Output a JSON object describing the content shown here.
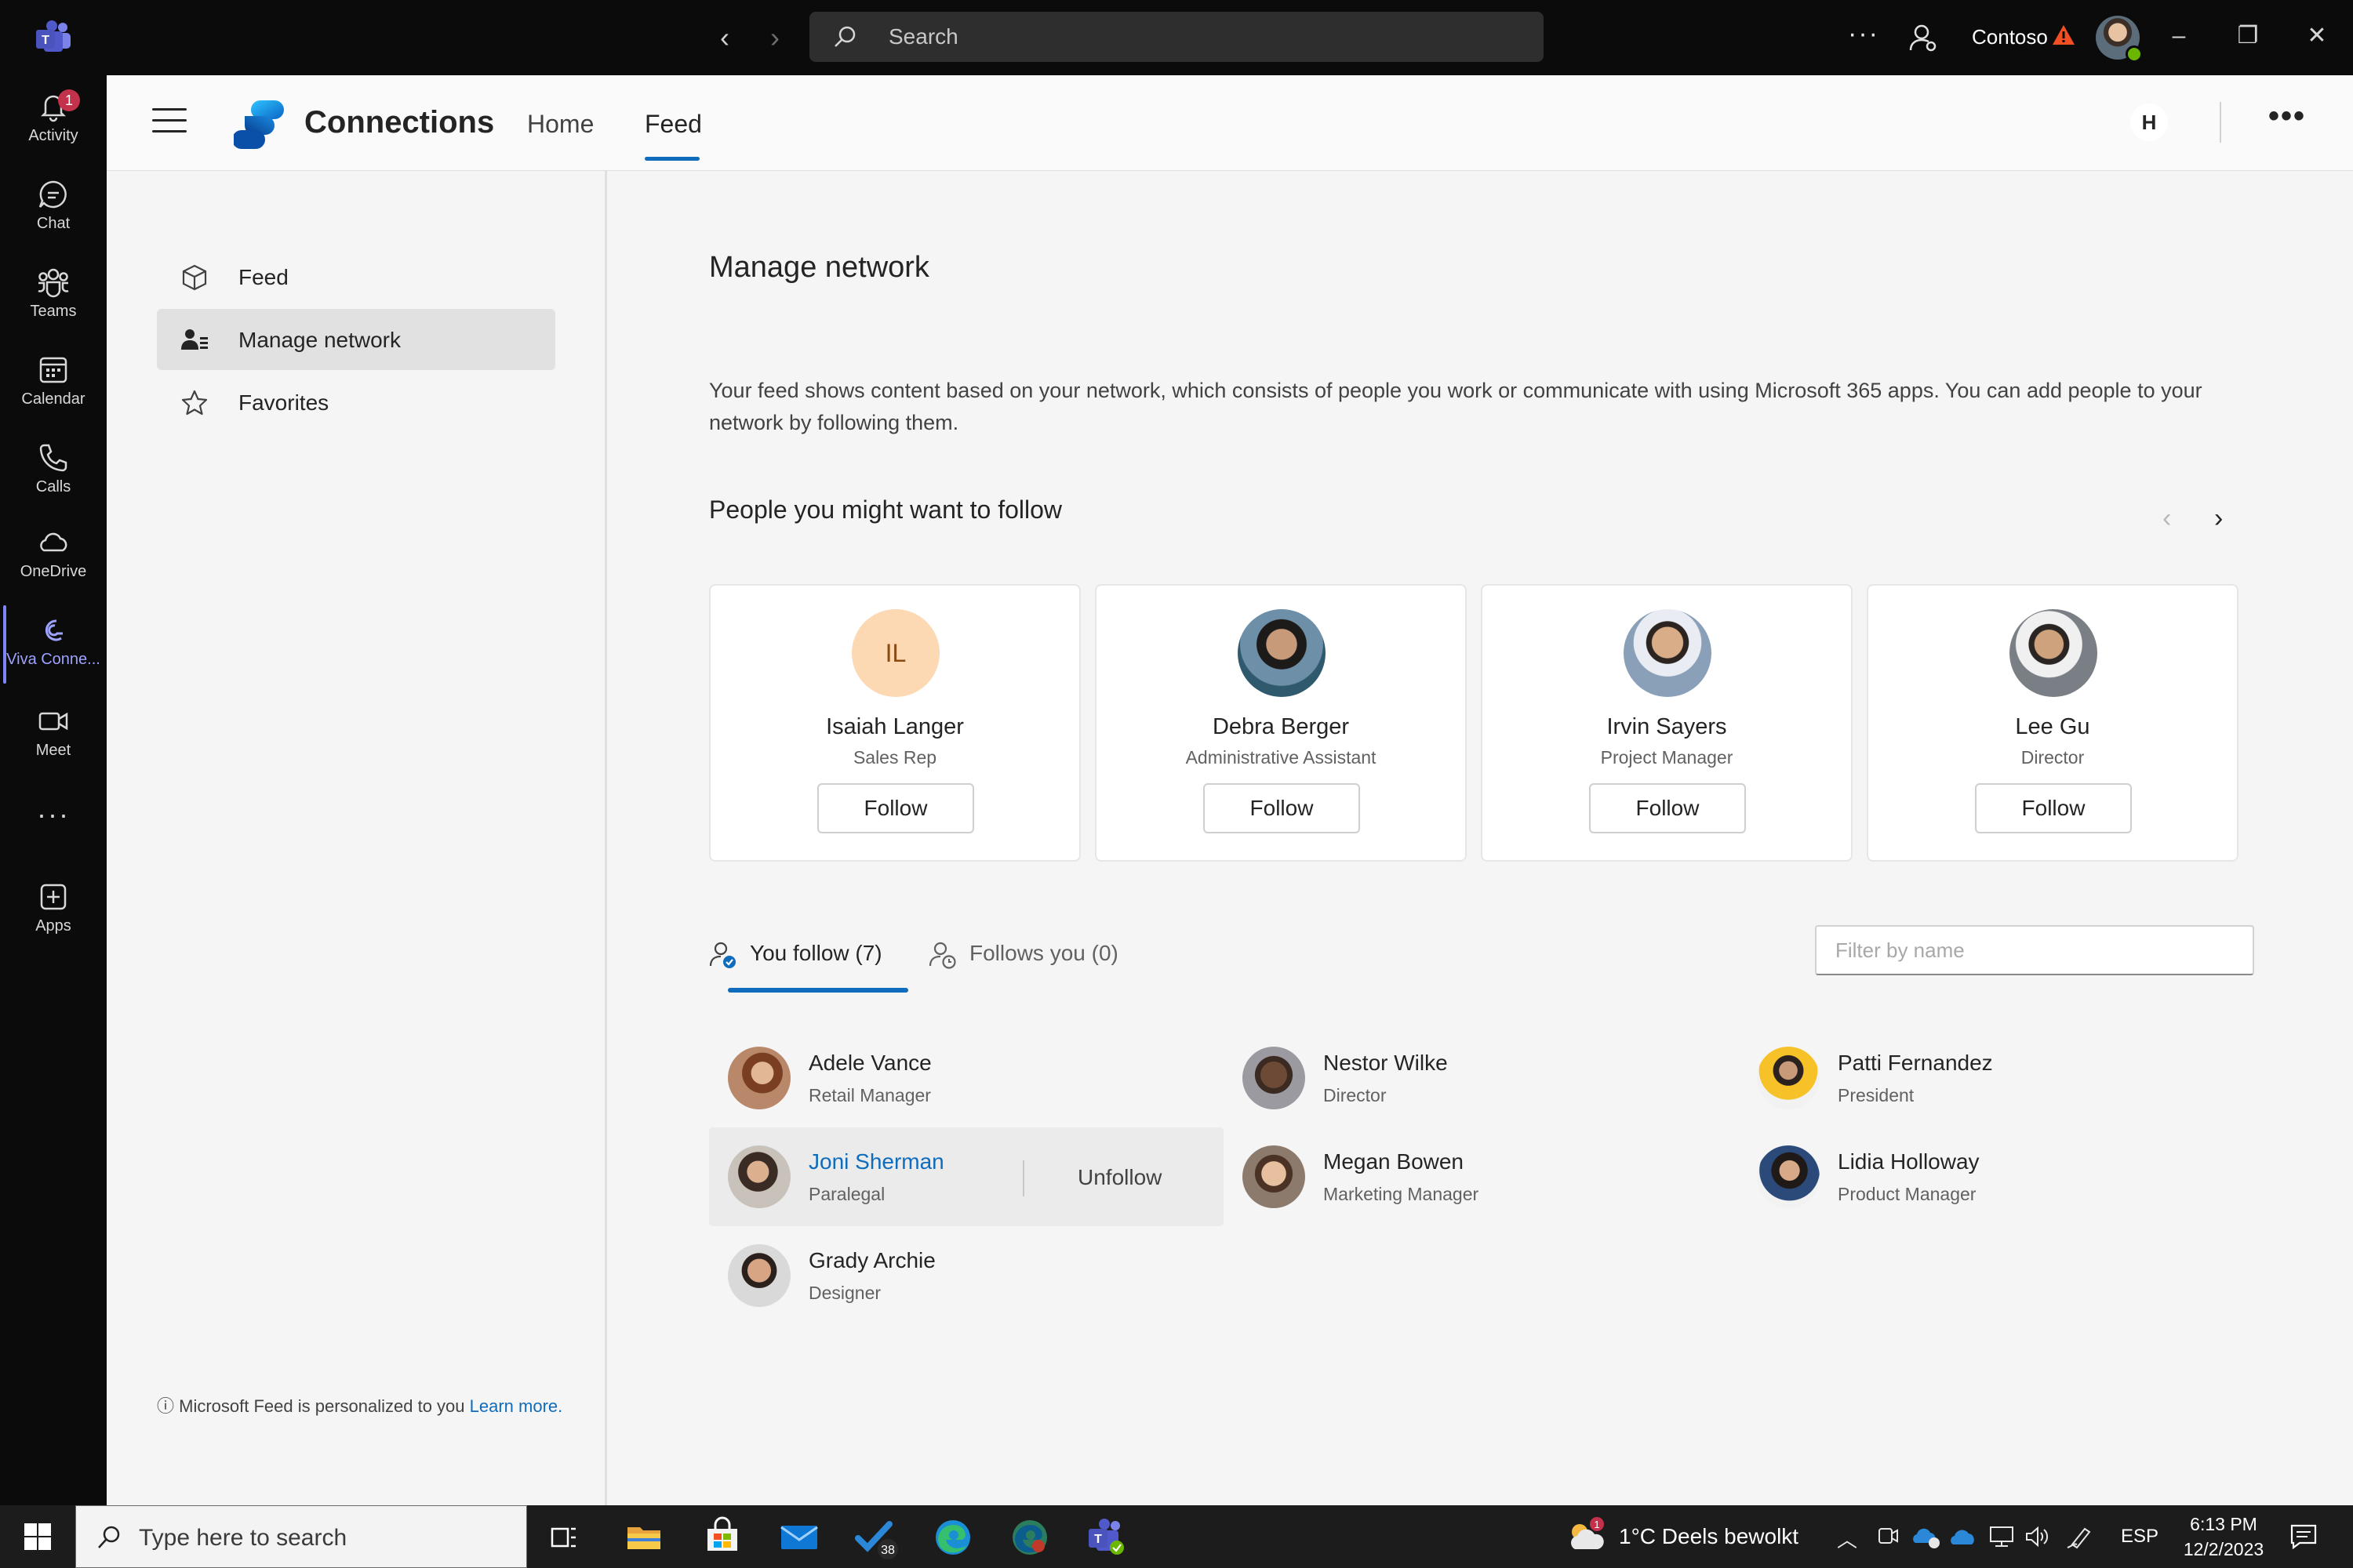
{
  "titlebar": {
    "search_placeholder": "Search",
    "org_name": "Contoso",
    "more_label": "···"
  },
  "rail": {
    "items": [
      {
        "label": "Activity",
        "icon": "bell-icon",
        "badge": "1"
      },
      {
        "label": "Chat",
        "icon": "chat-icon"
      },
      {
        "label": "Teams",
        "icon": "teams-icon"
      },
      {
        "label": "Calendar",
        "icon": "calendar-icon"
      },
      {
        "label": "Calls",
        "icon": "phone-icon"
      },
      {
        "label": "OneDrive",
        "icon": "cloud-icon"
      },
      {
        "label": "Viva Conne...",
        "icon": "viva-connections-icon",
        "active": true
      },
      {
        "label": "Meet",
        "icon": "video-icon"
      },
      {
        "label": "Apps",
        "icon": "add-app-icon"
      }
    ]
  },
  "header": {
    "app_name": "Connections",
    "tabs": [
      {
        "label": "Home"
      },
      {
        "label": "Feed",
        "active": true
      }
    ],
    "h_badge": "H"
  },
  "nav": {
    "items": [
      {
        "label": "Feed",
        "icon": "feed-box-icon"
      },
      {
        "label": "Manage network",
        "icon": "people-icon",
        "active": true
      },
      {
        "label": "Favorites",
        "icon": "star-icon"
      }
    ],
    "footer_text": "ⓘ Microsoft Feed is personalized to you ",
    "footer_link": "Learn more."
  },
  "main": {
    "title": "Manage network",
    "description": "Your feed shows content based on your network, which consists of people you work or communicate with using Microsoft 365 apps. You can add people to your network by following them.",
    "suggest_title": "People you might want to follow",
    "suggestions": [
      {
        "name": "Isaiah Langer",
        "role": "Sales Rep",
        "initials": "IL",
        "button": "Follow"
      },
      {
        "name": "Debra Berger",
        "role": "Administrative Assistant",
        "button": "Follow"
      },
      {
        "name": "Irvin Sayers",
        "role": "Project Manager",
        "button": "Follow"
      },
      {
        "name": "Lee Gu",
        "role": "Director",
        "button": "Follow"
      }
    ],
    "tabs": [
      {
        "label": "You follow (7)",
        "active": true
      },
      {
        "label": "Follows you (0)"
      }
    ],
    "filter_placeholder": "Filter by name",
    "following": [
      {
        "name": "Adele Vance",
        "role": "Retail Manager"
      },
      {
        "name": "Nestor Wilke",
        "role": "Director"
      },
      {
        "name": "Patti Fernandez",
        "role": "President"
      },
      {
        "name": "Joni Sherman",
        "role": "Paralegal",
        "action": "Unfollow"
      },
      {
        "name": "Megan Bowen",
        "role": "Marketing Manager"
      },
      {
        "name": "Lidia Holloway",
        "role": "Product Manager"
      },
      {
        "name": "Grady Archie",
        "role": "Designer"
      }
    ]
  },
  "taskbar": {
    "search_placeholder": "Type here to search",
    "todo_badge": "38",
    "weather_badge": "1",
    "weather": "1°C  Deels bewolkt",
    "language": "ESP",
    "time": "6:13 PM",
    "date": "12/2/2023"
  },
  "colors": {
    "accent": "#0f6cbd",
    "rail_active": "#7f85f5",
    "initials_bg": "#fcd8b3"
  }
}
